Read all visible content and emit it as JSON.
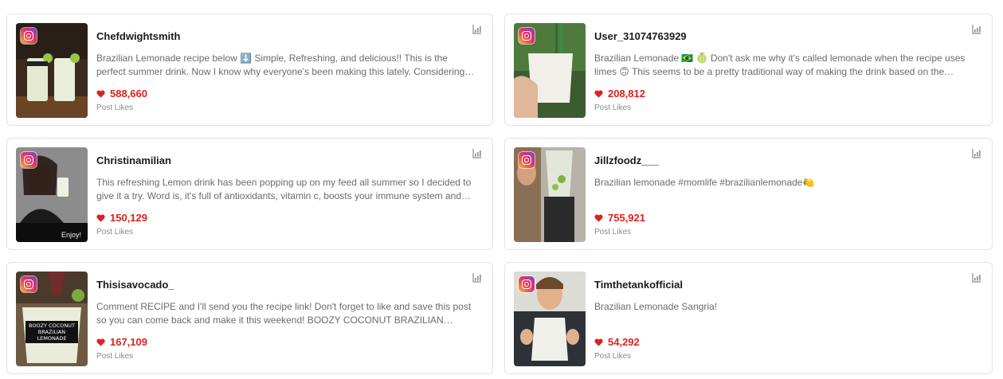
{
  "cards": [
    {
      "username": "Chefdwightsmith",
      "description": "Brazilian Lemonade recipe below ⬇️ Simple, Refreshing, and delicious!! This is the perfect summer drink. Now I know why everyone's been making this lately. Considering how easy it is…",
      "likes": "588,660",
      "likes_label": "Post Likes",
      "thumb_caption": ""
    },
    {
      "username": "User_31074763929",
      "description": "Brazilian Lemonade 🇧🇷 🍈 Don't ask me why it's called lemonade when the recipe uses limes 🙃 This seems to be a pretty traditional way of making the drink based on the…",
      "likes": "208,812",
      "likes_label": "Post Likes",
      "thumb_caption": ""
    },
    {
      "username": "Christinamilian",
      "description": "This refreshing Lemon drink has been popping up on my feed all summer so I decided to give it a try. Word is, it's full of antioxidants, vitamin c, boosts your immune system and…",
      "likes": "150,129",
      "likes_label": "Post Likes",
      "thumb_caption": "Enjoy!"
    },
    {
      "username": "Jillzfoodz___",
      "description": "Brazilian lemonade #momlife #brazilianlemonade🍋",
      "likes": "755,921",
      "likes_label": "Post Likes",
      "thumb_caption": ""
    },
    {
      "username": "Thisisavocado_",
      "description": "Comment RECIPE and I'll send you the recipe link! Don't forget to like and save this post so you can come back and make it this weekend! BOOZY COCONUT BRAZILIAN…",
      "likes": "167,109",
      "likes_label": "Post Likes",
      "thumb_caption": "BOOZY COCONUT BRAZILIAN LEMONADE"
    },
    {
      "username": "Timthetankofficial",
      "description": "Brazilian Lemonade Sangria!",
      "likes": "54,292",
      "likes_label": "Post Likes",
      "thumb_caption": ""
    }
  ],
  "icons": {
    "platform": "instagram-icon",
    "likes": "heart-icon",
    "stats": "chart-stats-icon"
  },
  "colors": {
    "likes": "#d9231f",
    "border": "#e3e3e6",
    "muted_text": "#6b6b6b"
  }
}
